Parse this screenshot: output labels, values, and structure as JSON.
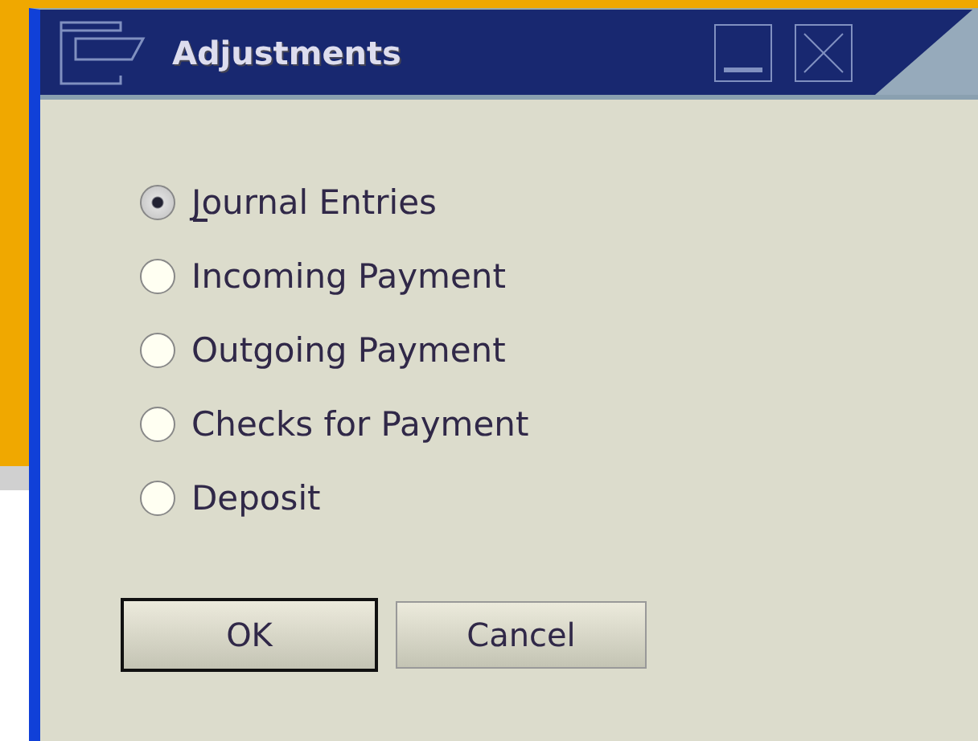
{
  "window": {
    "title": "Adjustments"
  },
  "options": [
    {
      "label": "Journal Entries",
      "selected": true,
      "focused": true
    },
    {
      "label": "Incoming Payment",
      "selected": false,
      "focused": false
    },
    {
      "label": "Outgoing Payment",
      "selected": false,
      "focused": false
    },
    {
      "label": "Checks for Payment",
      "selected": false,
      "focused": false
    },
    {
      "label": "Deposit",
      "selected": false,
      "focused": false
    }
  ],
  "buttons": [
    {
      "label": "OK",
      "default": true
    },
    {
      "label": "Cancel",
      "default": false
    }
  ]
}
